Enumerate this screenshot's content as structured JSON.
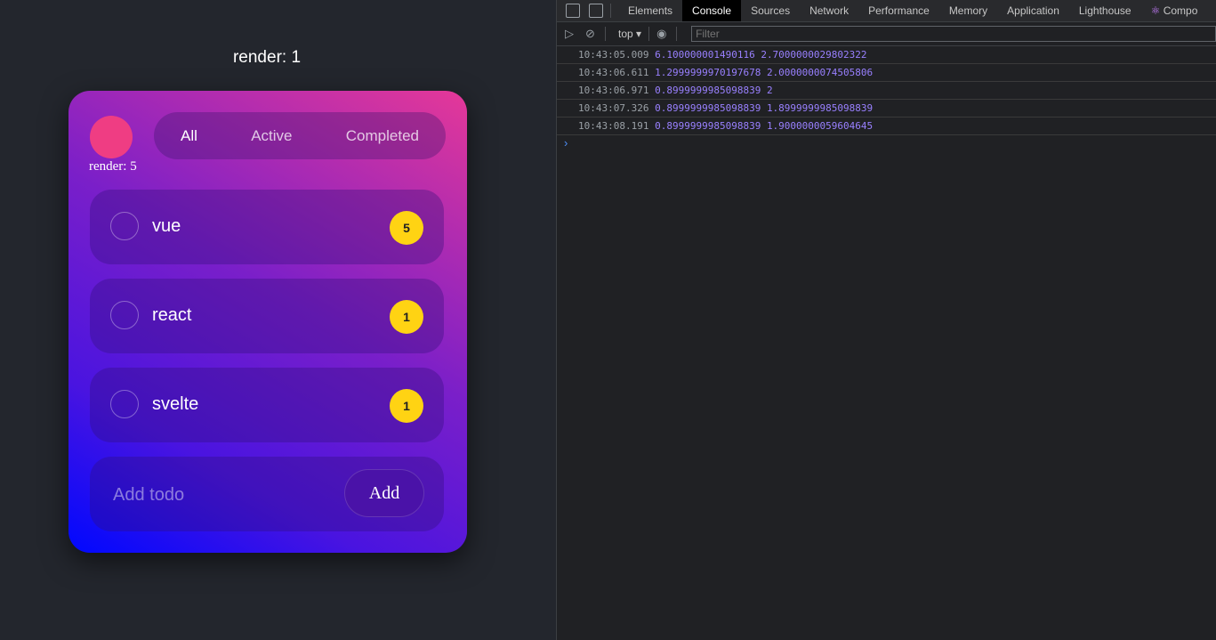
{
  "app": {
    "render_label": "render: 1",
    "card_render_label": "render: 5",
    "filters": [
      "All",
      "Active",
      "Completed"
    ],
    "active_filter": "All",
    "todos": [
      {
        "label": "vue",
        "count": "5"
      },
      {
        "label": "react",
        "count": "1"
      },
      {
        "label": "svelte",
        "count": "1"
      }
    ],
    "add_placeholder": "Add todo",
    "add_button": "Add",
    "colors": {
      "avatar": "#ef3d83",
      "badge": "#ffd313"
    }
  },
  "devtools": {
    "tabs": [
      "Elements",
      "Console",
      "Sources",
      "Network",
      "Performance",
      "Memory",
      "Application",
      "Lighthouse",
      "Compo"
    ],
    "active_tab": "Console",
    "context": "top",
    "filter_placeholder": "Filter",
    "logs": [
      {
        "time": "10:43:05.009",
        "values": "6.100000001490116 2.7000000029802322"
      },
      {
        "time": "10:43:06.611",
        "values": "1.2999999970197678 2.0000000074505806"
      },
      {
        "time": "10:43:06.971",
        "values": "0.8999999985098839 2"
      },
      {
        "time": "10:43:07.326",
        "values": "0.8999999985098839 1.8999999985098839"
      },
      {
        "time": "10:43:08.191",
        "values": "0.8999999985098839 1.9000000059604645"
      }
    ],
    "prompt": "›"
  }
}
